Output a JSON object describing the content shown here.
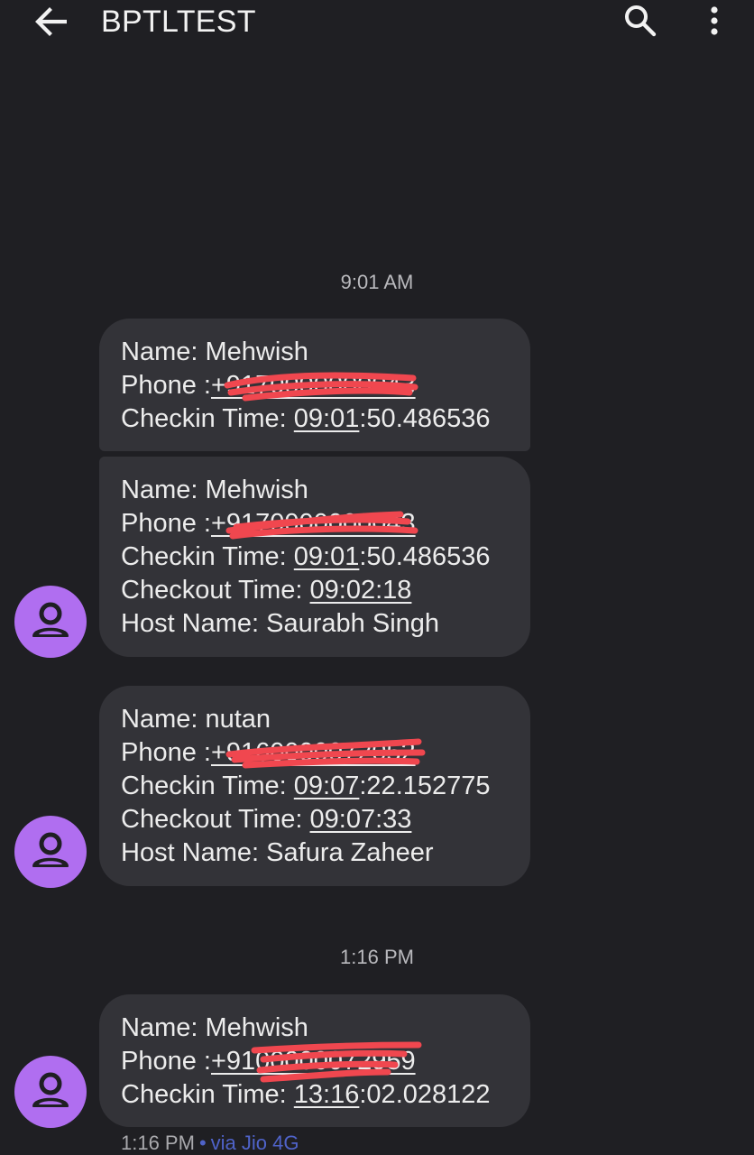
{
  "header": {
    "title": "BPTLTEST",
    "back_icon": "arrow-left-icon",
    "search_icon": "search-icon",
    "more_icon": "more-vert-icon"
  },
  "timestamps": [
    "9:01 AM",
    "1:16 PM"
  ],
  "messages": [
    {
      "name_prefix": "Name: ",
      "name": "Mehwish",
      "phone_prefix": "Phone :",
      "phone": "+9170000000043",
      "checkin_prefix": "Checkin Time: ",
      "checkin_link": "09:01",
      "checkin_rest": ":50.486536"
    },
    {
      "name_prefix": "Name: ",
      "name": "Mehwish",
      "phone_prefix": "Phone :",
      "phone": "+9170000000043",
      "checkin_prefix": "Checkin Time: ",
      "checkin_link": "09:01",
      "checkin_rest": ":50.486536",
      "checkout_prefix": "Checkout Time: ",
      "checkout": "09:02:18",
      "host_prefix": "Host Name: ",
      "host": "Saurabh Singh"
    },
    {
      "name_prefix": "Name: ",
      "name": "nutan",
      "phone_prefix": "Phone :",
      "phone": "+9160000072052",
      "checkin_prefix": "Checkin Time: ",
      "checkin_link": "09:07",
      "checkin_rest": ":22.152775",
      "checkout_prefix": "Checkout Time: ",
      "checkout": "09:07:33",
      "host_prefix": "Host Name: ",
      "host": "Safura Zaheer"
    },
    {
      "name_prefix": "Name: ",
      "name": "Mehwish",
      "phone_prefix": "Phone :",
      "phone": "+9100000072959",
      "checkin_prefix": "Checkin Time: ",
      "checkin_link": "13:16",
      "checkin_rest": ":02.028122"
    }
  ],
  "footer": {
    "time": "1:16 PM",
    "dot": "•",
    "via": "via Jio 4G"
  },
  "colors": {
    "background": "#1f1f23",
    "bubble": "#333338",
    "avatar": "#b06ef0",
    "redaction": "#f0474f",
    "via_link": "#4f63c9"
  }
}
